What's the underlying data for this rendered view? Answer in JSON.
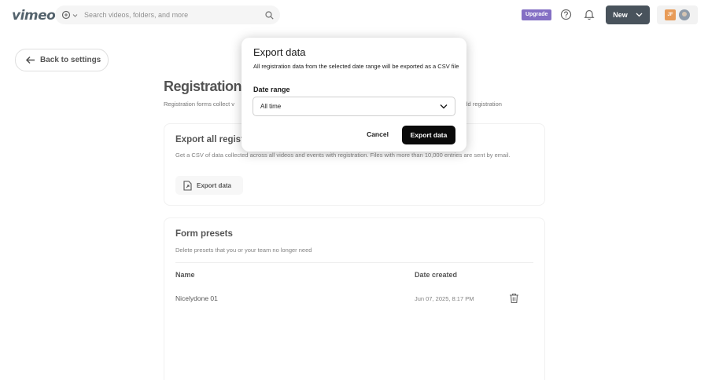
{
  "topbar": {
    "logo": "vimeo",
    "search_placeholder": "Search videos, folders, and more",
    "upgrade_label": "Upgrade",
    "new_label": "New",
    "avatar_initials": "JF"
  },
  "back_label": "Back to settings",
  "page": {
    "title": "Registration",
    "subtitle_left": "Registration forms collect v",
    "subtitle_right": "add registration"
  },
  "export_card": {
    "title": "Export all regist",
    "description": "Get a CSV of data collected across all videos and events with registration. Files with more than 10,000 entries are sent by email.",
    "button_label": "Export data"
  },
  "presets_card": {
    "title": "Form presets",
    "description": "Delete presets that you or your team no longer need",
    "col_name": "Name",
    "col_date": "Date created",
    "rows": [
      {
        "name": "Nicelydone 01",
        "date": "Jun 07, 2025, 8:17 PM"
      }
    ]
  },
  "modal": {
    "title": "Export data",
    "description": "All registration data from the selected date range will be exported as a CSV file",
    "date_range_label": "Date range",
    "date_range_value": "All time",
    "cancel_label": "Cancel",
    "export_label": "Export data"
  },
  "colors": {
    "accent": "#0a0a0a",
    "upgrade": "#5b3fb0",
    "logo": "#1a2e3b"
  }
}
